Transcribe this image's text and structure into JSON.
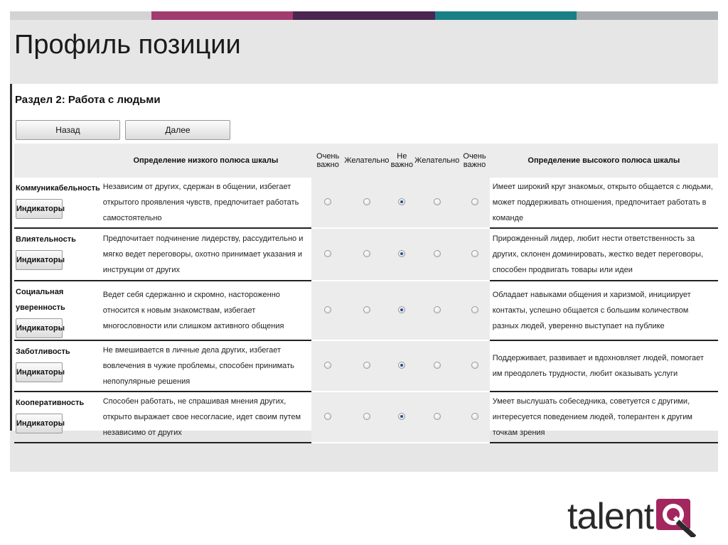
{
  "slide": {
    "title": "Профиль позиции",
    "bar_colors": [
      "#d3d3d5",
      "#a13c6e",
      "#4a2650",
      "#1b7f86",
      "#a7abb0"
    ],
    "logo_text": "talent",
    "logo_mark": "Q",
    "logo_color": "#a3265e"
  },
  "form": {
    "section_title": "Раздел 2: Работа с людьми",
    "back_label": "Назад",
    "next_label": "Далее",
    "indicators_label": "Индикаторы",
    "headers": {
      "low_def": "Определение низкого полюса шкалы",
      "very_important_1": "Очень важно",
      "desirable_1": "Желательно",
      "not_important": "Не важно",
      "desirable_2": "Желательно",
      "very_important_2": "Очень важно",
      "high_def": "Определение высокого полюса шкалы"
    },
    "rows": [
      {
        "name": "Коммуникабельность",
        "low": "Независим от других, сдержан в общении, избегает открытого проявления чувств, предпочитает работать самостоятельно",
        "high": "Имеет широкий круг знакомых, открыто общается с людьми, может поддерживать отношения, предпочитает работать в команде",
        "selected": 2
      },
      {
        "name": "Влиятельность",
        "low": "Предпочитает подчинение лидерству, рассудительно и мягко ведет переговоры, охотно принимает указания и инструкции от других",
        "high": "Прирожденный лидер, любит нести ответственность за других, склонен доминировать, жестко ведет переговоры, способен продвигать товары или идеи",
        "selected": 2
      },
      {
        "name": "Социальная уверенность",
        "low": "Ведет себя сдержанно и скромно, настороженно относится к новым знакомствам, избегает многословности или слишком активного общения",
        "high": "Обладает навыками общения и харизмой, инициирует контакты, успешно общается с большим количеством разных людей, уверенно выступает на публике",
        "selected": 2
      },
      {
        "name": "Заботливость",
        "low": "Не вмешивается в личные дела других, избегает вовлечения в чужие проблемы, способен принимать непопулярные решения",
        "high": "Поддерживает, развивает и вдохновляет людей, помогает им преодолеть трудности, любит оказывать услуги",
        "selected": 2
      },
      {
        "name": "Кооперативность",
        "low": "Способен работать, не спрашивая мнения других, открыто выражает свое несогласие, идет своим путем независимо от других",
        "high": "Умеет выслушать собеседника, советуется с другими, интересуется поведением людей, толерантен к другим точкам зрения",
        "selected": 2
      }
    ]
  }
}
